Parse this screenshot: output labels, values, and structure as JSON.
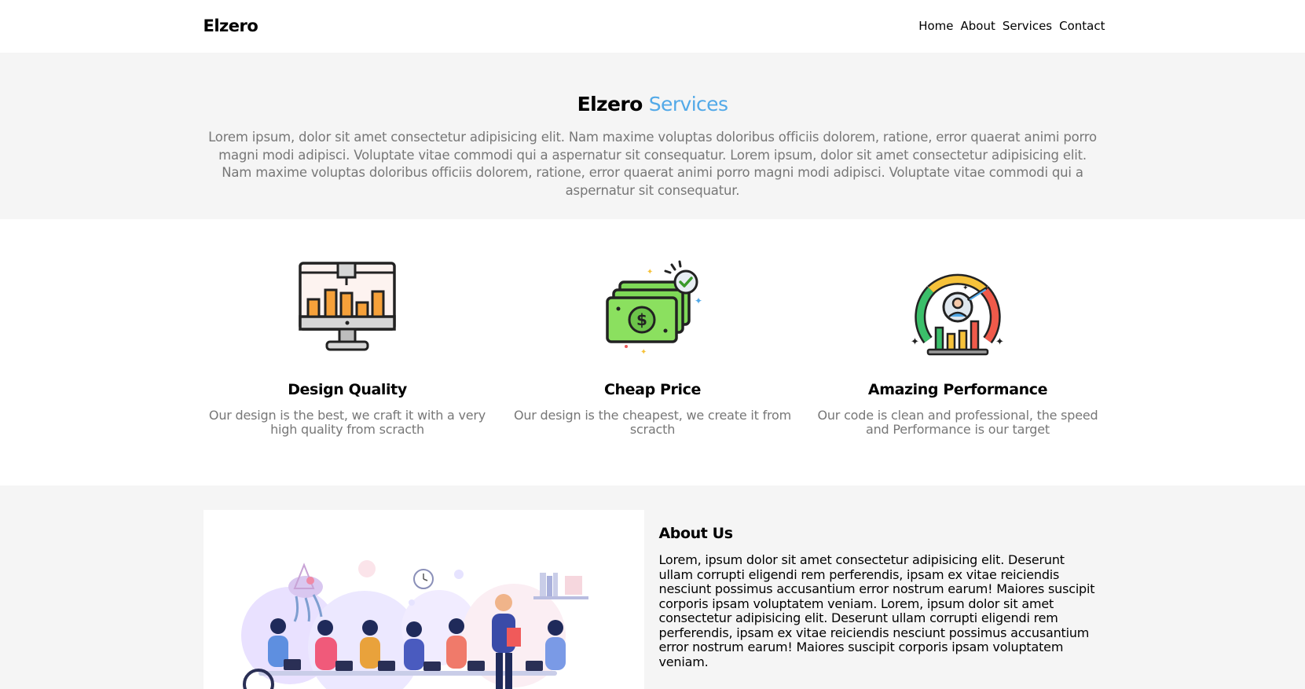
{
  "header": {
    "logo": "Elzero",
    "nav": [
      {
        "label": "Home"
      },
      {
        "label": "About"
      },
      {
        "label": "Services"
      },
      {
        "label": "Contact"
      }
    ]
  },
  "services": {
    "title_main": "Elzero",
    "title_accent": "Services",
    "accent_color": "#52a9e8",
    "description": "Lorem ipsum, dolor sit amet consectetur adipisicing elit. Nam maxime voluptas doloribus officiis dolorem, ratione, error quaerat animi porro magni modi adipisci. Voluptate vitae commodi qui a aspernatur sit consequatur. Lorem ipsum, dolor sit amet consectetur adipisicing elit. Nam maxime voluptas doloribus officiis dolorem, ratione, error quaerat animi porro magni modi adipisci. Voluptate vitae commodi qui a aspernatur sit consequatur."
  },
  "features": [
    {
      "icon": "monitor-chart-icon",
      "title": "Design Quality",
      "text": "Our design is the best, we craft it with a very high quality from scracth"
    },
    {
      "icon": "money-stack-icon",
      "title": "Cheap Price",
      "text": "Our design is the cheapest, we create it from scracth"
    },
    {
      "icon": "performance-gauge-icon",
      "title": "Amazing Performance",
      "text": "Our code is clean and professional, the speed and Performance is our target"
    }
  ],
  "about": {
    "image": "team-meeting-illustration",
    "title": "About Us",
    "text": "Lorem, ipsum dolor sit amet consectetur adipisicing elit. Deserunt ullam corrupti eligendi rem perferendis, ipsam ex vitae reiciendis nesciunt possimus accusantium error nostrum earum! Maiores suscipit corporis ipsam voluptatem veniam. Lorem, ipsum dolor sit amet consectetur adipisicing elit. Deserunt ullam corrupti eligendi rem perferendis, ipsam ex vitae reiciendis nesciunt possimus accusantium error nostrum earum! Maiores suscipit corporis ipsam voluptatem veniam."
  }
}
